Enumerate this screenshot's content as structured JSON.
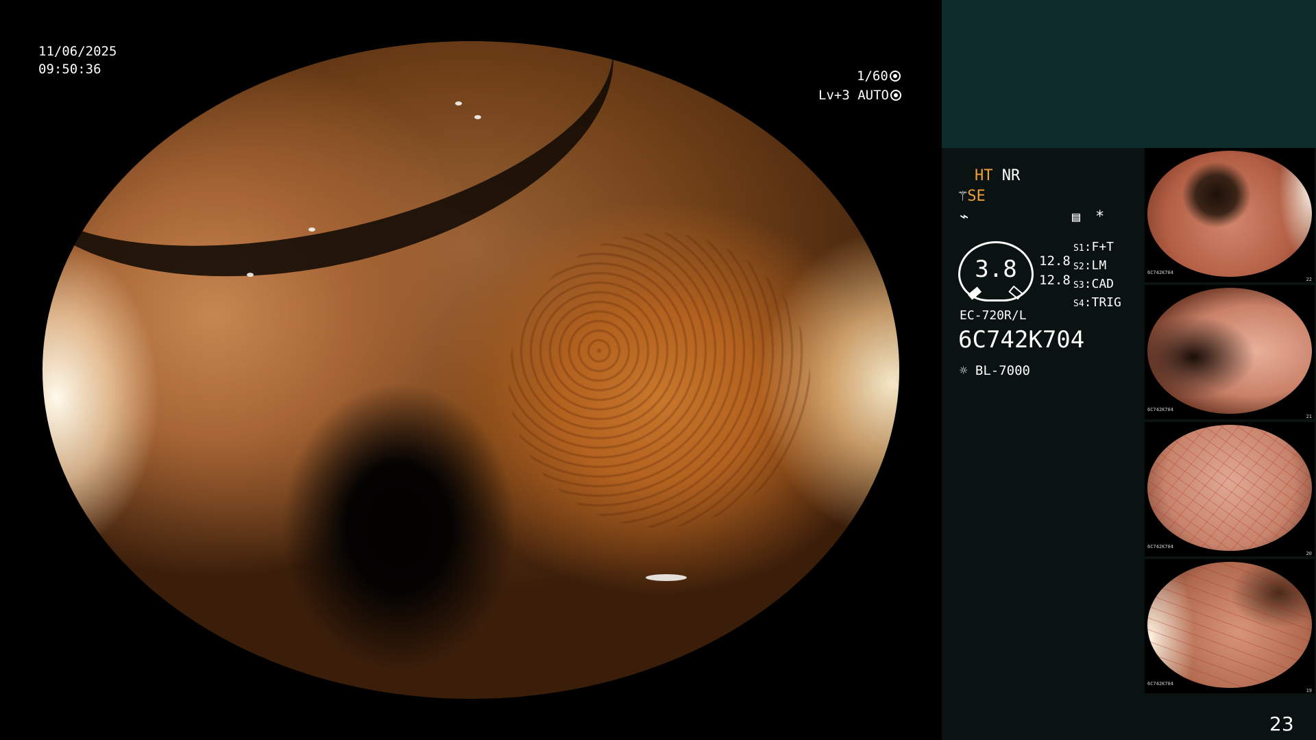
{
  "overlay": {
    "date": "11/06/2025",
    "time": "09:50:36",
    "shutter": "1/60",
    "level": "Lv+3",
    "exposure_mode": "AUTO"
  },
  "side": {
    "ht": "HT",
    "nr": "NR",
    "se": "SE",
    "zoom_value": "3.8",
    "gauge_side_top": "12.8",
    "gauge_side_bottom": "12.8",
    "switches": [
      {
        "key": "S1",
        "label": "F+T"
      },
      {
        "key": "S2",
        "label": "LM"
      },
      {
        "key": "S3",
        "label": "CAD"
      },
      {
        "key": "S4",
        "label": "TRIG"
      }
    ],
    "scope_model": "EC-720R/L",
    "serial": "6C742K704",
    "light_source": "BL-7000",
    "asterisk": "*"
  },
  "thumbnails": [
    {
      "label": "6C742K704",
      "index": "22"
    },
    {
      "label": "6C742K704",
      "index": "21"
    },
    {
      "label": "6C742K704",
      "index": "20"
    },
    {
      "label": "6C742K704",
      "index": "19"
    }
  ],
  "page_number": "23",
  "icons": [
    "shutter-icon",
    "auto-exposure-icon",
    "scope-tip-icon",
    "lightning-icon",
    "settings-panel-icon",
    "light-source-icon"
  ],
  "colors": {
    "accent_orange": "#f0a03c",
    "panel_top": "#0f2c2c",
    "panel_bg": "#0a1212"
  }
}
